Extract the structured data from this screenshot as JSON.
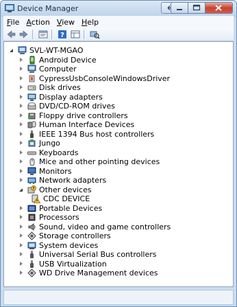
{
  "window": {
    "title": "Device Manager"
  },
  "menu": [
    {
      "label": "File",
      "mnemonic": "F",
      "rest": "ile"
    },
    {
      "label": "Action",
      "mnemonic": "A",
      "rest": "ction"
    },
    {
      "label": "View",
      "mnemonic": "V",
      "rest": "iew"
    },
    {
      "label": "Help",
      "mnemonic": "H",
      "rest": "elp"
    }
  ],
  "toolbar": [
    {
      "name": "back-icon"
    },
    {
      "name": "forward-icon"
    },
    {
      "name": "properties-icon"
    },
    {
      "name": "help-icon"
    },
    {
      "name": "show-hide-icon"
    },
    {
      "name": "scan-hardware-icon"
    }
  ],
  "tree": {
    "root": {
      "label": "SVL-WT-MGAO",
      "icon": "computer-icon",
      "expanded": true
    },
    "items": [
      {
        "label": "Android Device",
        "icon": "phone-icon"
      },
      {
        "label": "Computer",
        "icon": "computer-icon"
      },
      {
        "label": "CypressUsbConsoleWindowsDriver",
        "icon": "usb-device-icon"
      },
      {
        "label": "Disk drives",
        "icon": "disk-drive-icon"
      },
      {
        "label": "Display adapters",
        "icon": "display-adapter-icon"
      },
      {
        "label": "DVD/CD-ROM drives",
        "icon": "dvd-drive-icon"
      },
      {
        "label": "Floppy drive controllers",
        "icon": "floppy-controller-icon"
      },
      {
        "label": "Human Interface Devices",
        "icon": "hid-icon"
      },
      {
        "label": "IEEE 1394 Bus host controllers",
        "icon": "firewire-icon"
      },
      {
        "label": "Jungo",
        "icon": "jungo-icon"
      },
      {
        "label": "Keyboards",
        "icon": "keyboard-icon"
      },
      {
        "label": "Mice and other pointing devices",
        "icon": "mouse-icon"
      },
      {
        "label": "Monitors",
        "icon": "monitor-icon"
      },
      {
        "label": "Network adapters",
        "icon": "network-adapter-icon"
      },
      {
        "label": "Other devices",
        "icon": "other-devices-icon",
        "expanded": true,
        "children": [
          {
            "label": "CDC DEVICE",
            "icon": "unknown-device-warning-icon"
          }
        ]
      },
      {
        "label": "Portable Devices",
        "icon": "portable-device-icon"
      },
      {
        "label": "Processors",
        "icon": "processor-icon"
      },
      {
        "label": "Sound, video and game controllers",
        "icon": "sound-icon"
      },
      {
        "label": "Storage controllers",
        "icon": "storage-controller-icon"
      },
      {
        "label": "System devices",
        "icon": "system-devices-icon"
      },
      {
        "label": "Universal Serial Bus controllers",
        "icon": "usb-controller-icon"
      },
      {
        "label": "USB Virtualization",
        "icon": "usb-virtualization-icon"
      },
      {
        "label": "WD Drive Management devices",
        "icon": "wd-drive-icon"
      }
    ]
  }
}
